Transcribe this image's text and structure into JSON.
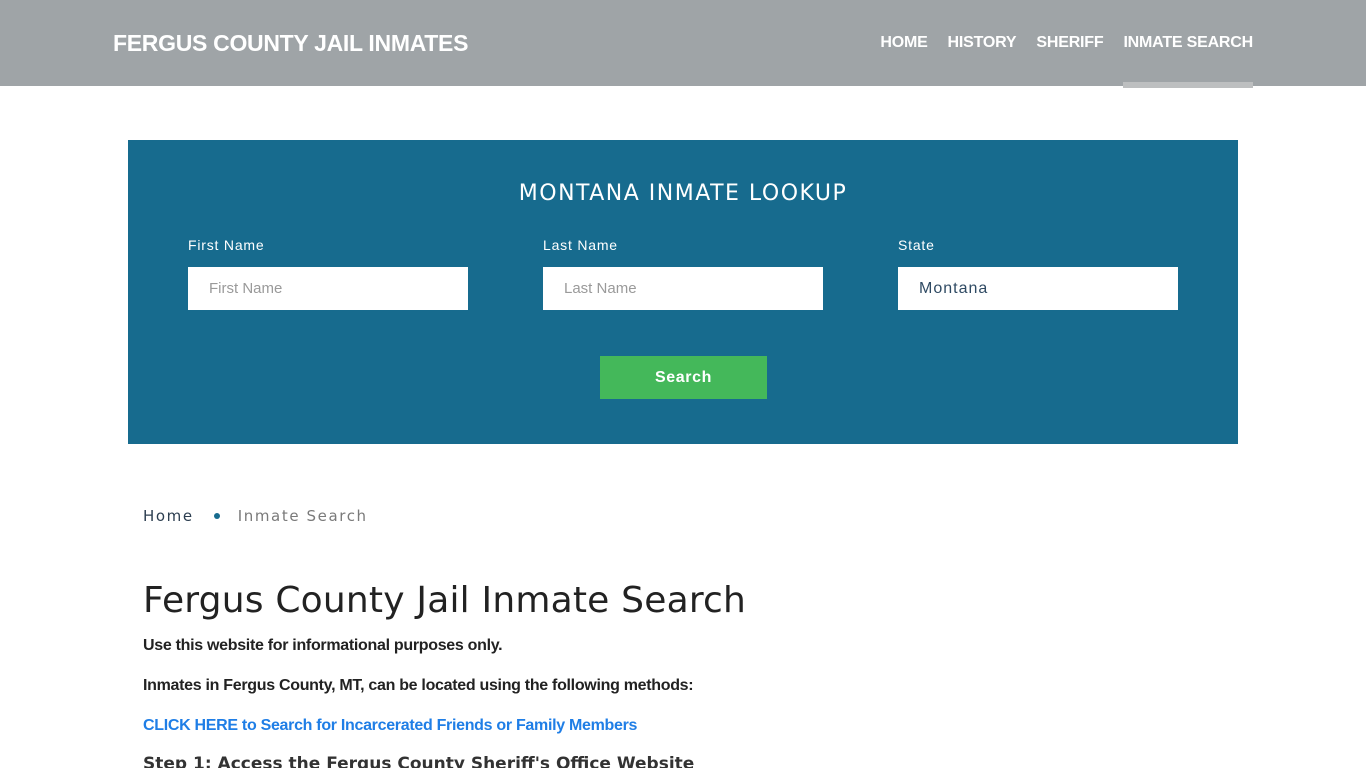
{
  "header": {
    "brand": "FERGUS COUNTY JAIL INMATES",
    "nav": [
      {
        "label": "HOME",
        "active": false
      },
      {
        "label": "HISTORY",
        "active": false
      },
      {
        "label": "SHERIFF",
        "active": false
      },
      {
        "label": "INMATE SEARCH",
        "active": true
      }
    ]
  },
  "lookup": {
    "title": "MONTANA INMATE LOOKUP",
    "first_name": {
      "label": "First Name",
      "placeholder": "First Name",
      "value": ""
    },
    "last_name": {
      "label": "Last Name",
      "placeholder": "Last Name",
      "value": ""
    },
    "state": {
      "label": "State",
      "value": "Montana"
    },
    "search_label": "Search"
  },
  "breadcrumb": {
    "home": "Home",
    "current": "Inmate Search"
  },
  "content": {
    "title": "Fergus County Jail Inmate Search",
    "disclaimer": "Use this website for informational purposes only.",
    "intro": "Inmates in Fergus County, MT, can be located using the following methods:",
    "cta_link": "CLICK HERE to Search for Incarcerated Friends or Family Members",
    "step1": "Step 1: Access the Fergus County Sheriff's Office Website"
  },
  "colors": {
    "header_bg": "#9fa4a7",
    "panel_bg": "#176b8e",
    "button_bg": "#44b85a",
    "link": "#1f7ee6"
  }
}
